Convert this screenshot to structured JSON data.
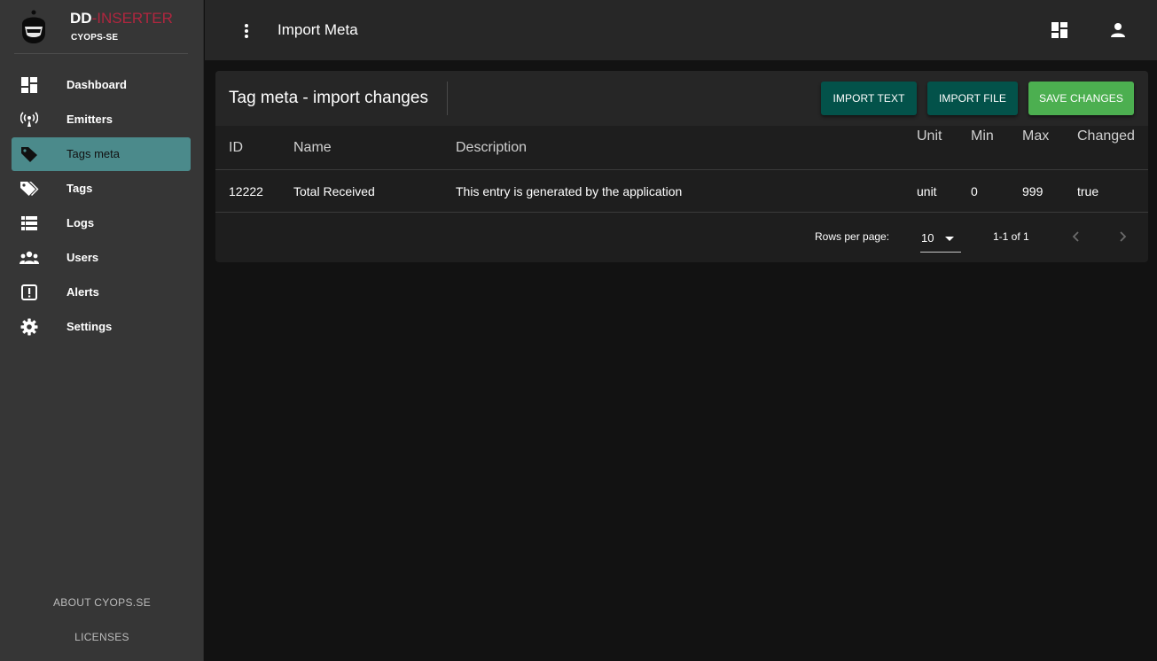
{
  "brand": {
    "title_bold": "DD",
    "title_accent": "-INSERTER",
    "subtitle": "CYOPS-SE",
    "accent_color": "#b0263f"
  },
  "sidebar": {
    "active_color": "#4b8a8b",
    "items": [
      {
        "label": "Dashboard",
        "icon": "dashboard-icon",
        "active": false
      },
      {
        "label": "Emitters",
        "icon": "antenna-icon",
        "active": false
      },
      {
        "label": "Tags meta",
        "icon": "tag-icon",
        "active": true
      },
      {
        "label": "Tags",
        "icon": "tags-icon",
        "active": false
      },
      {
        "label": "Logs",
        "icon": "list-icon",
        "active": false
      },
      {
        "label": "Users",
        "icon": "users-icon",
        "active": false
      },
      {
        "label": "Alerts",
        "icon": "alert-box-icon",
        "active": false
      },
      {
        "label": "Settings",
        "icon": "gear-icon",
        "active": false
      }
    ],
    "footer": {
      "about": "ABOUT CYOPS.SE",
      "licenses": "LICENSES"
    }
  },
  "topbar": {
    "title": "Import Meta",
    "icons": [
      "more-vertical-icon",
      "dashboard-icon",
      "account-icon"
    ]
  },
  "card": {
    "title": "Tag meta - import changes",
    "buttons": {
      "import_text": "IMPORT TEXT",
      "import_file": "IMPORT FILE",
      "save_changes": "SAVE CHANGES"
    },
    "button_colors": {
      "teal": "#03524a",
      "green": "#4caf50"
    },
    "table": {
      "headers": {
        "id": "ID",
        "name": "Name",
        "description": "Description",
        "unit": "Unit",
        "min": "Min",
        "max": "Max",
        "changed": "Changed"
      },
      "rows": [
        {
          "id": "12222",
          "name": "Total Received",
          "description": "This entry is generated by the application",
          "unit": "unit",
          "min": "0",
          "max": "999",
          "changed": "true"
        }
      ]
    },
    "pagination": {
      "rows_per_page_label": "Rows per page:",
      "rows_per_page_value": "10",
      "range": "1-1 of 1"
    }
  }
}
